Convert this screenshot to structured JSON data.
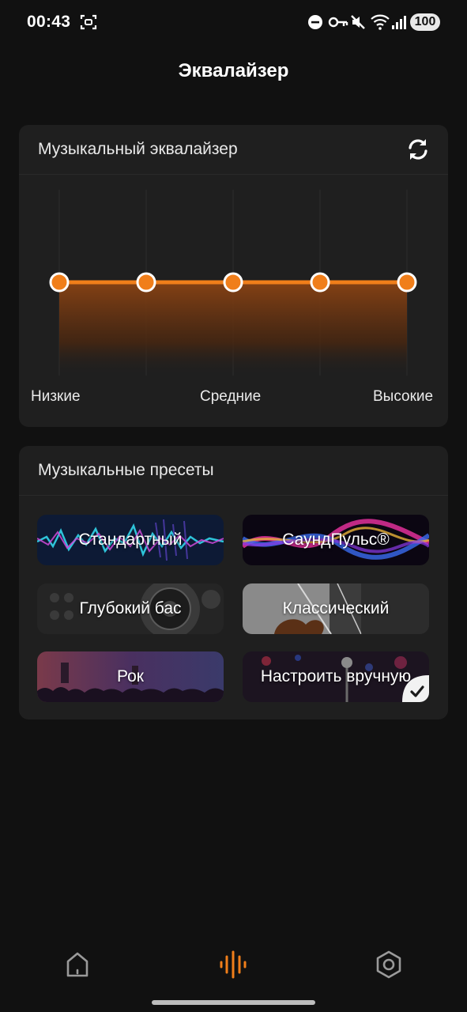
{
  "status_bar": {
    "time": "00:43",
    "battery": "100"
  },
  "header": {
    "title": "Эквалайзер"
  },
  "equalizer_card": {
    "title": "Музыкальный эквалайзер",
    "band_labels": {
      "low": "Низкие",
      "mid": "Средние",
      "high": "Высокие"
    },
    "bands": [
      {
        "level": 0
      },
      {
        "level": 0
      },
      {
        "level": 0
      },
      {
        "level": 0
      },
      {
        "level": 0
      }
    ],
    "accent_color": "#f07e1a"
  },
  "presets_card": {
    "title": "Музыкальные пресеты",
    "presets": [
      {
        "label": "Стандартный",
        "selected": false
      },
      {
        "label": "СаундПульс®",
        "selected": false
      },
      {
        "label": "Глубокий бас",
        "selected": false
      },
      {
        "label": "Классический",
        "selected": false
      },
      {
        "label": "Рок",
        "selected": false
      },
      {
        "label": "Настроить вручную",
        "selected": true
      }
    ]
  },
  "bottom_nav": {
    "items": [
      {
        "icon": "home-icon",
        "active": false
      },
      {
        "icon": "equalizer-wave-icon",
        "active": true
      },
      {
        "icon": "settings-hexagon-icon",
        "active": false
      }
    ],
    "active_color": "#f07e1a",
    "inactive_color": "#9a9a9a"
  }
}
